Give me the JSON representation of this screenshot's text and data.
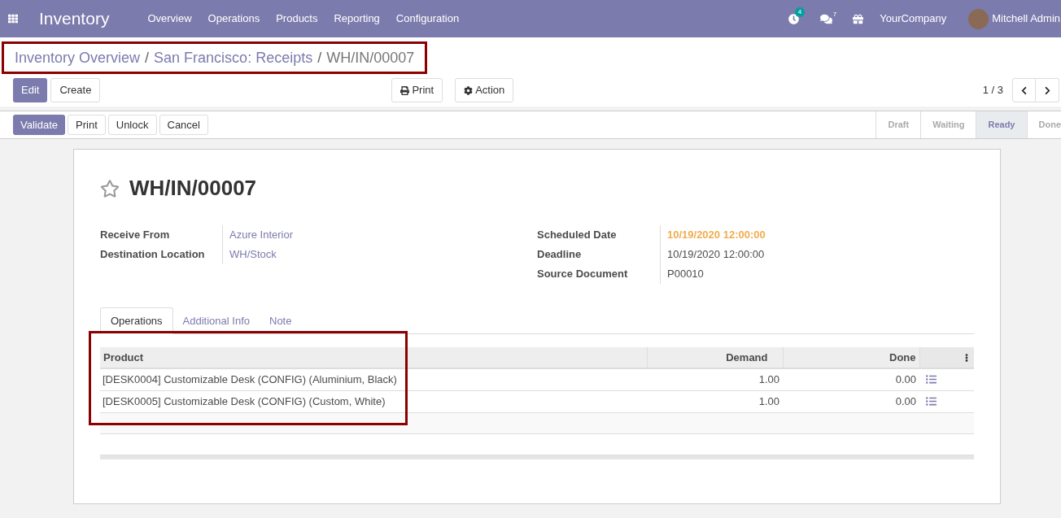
{
  "navbar": {
    "app_name": "Inventory",
    "menu": [
      "Overview",
      "Operations",
      "Products",
      "Reporting",
      "Configuration"
    ],
    "activity_count": "4",
    "message_count": "7",
    "company": "YourCompany",
    "user": "Mitchell Admin"
  },
  "breadcrumb": {
    "links": [
      "Inventory Overview",
      "San Francisco: Receipts"
    ],
    "separator": "/",
    "current": "WH/IN/00007",
    "highlighted": true
  },
  "control_buttons": [
    {
      "label": "Edit",
      "primary": true
    },
    {
      "label": "Create",
      "primary": false
    }
  ],
  "sidebar_buttons": [
    {
      "label": "Print",
      "kind": "print"
    },
    {
      "label": "Action",
      "kind": "action"
    }
  ],
  "pager": {
    "value": "1 / 3"
  },
  "action_buttons": [
    {
      "label": "Validate",
      "primary": true
    },
    {
      "label": "Print",
      "primary": false
    },
    {
      "label": "Unlock",
      "primary": false
    },
    {
      "label": "Cancel",
      "primary": false
    }
  ],
  "statusbar": [
    {
      "label": "Draft",
      "selected": false
    },
    {
      "label": "Waiting",
      "selected": false
    },
    {
      "label": "Ready",
      "selected": true
    },
    {
      "label": "Done",
      "selected": false
    }
  ],
  "record": {
    "title": "WH/IN/00007",
    "starred": false
  },
  "fields_left": [
    {
      "label": "Receive From",
      "value": "Azure Interior",
      "kind": "link"
    },
    {
      "label": "Destination Location",
      "value": "WH/Stock",
      "kind": "link"
    }
  ],
  "fields_right": [
    {
      "label": "Scheduled Date",
      "value": "10/19/2020 12:00:00",
      "kind": "warning"
    },
    {
      "label": "Deadline",
      "value": "10/19/2020 12:00:00",
      "kind": "text"
    },
    {
      "label": "Source Document",
      "value": "P00010",
      "kind": "text"
    }
  ],
  "tabs": [
    {
      "label": "Operations",
      "selected": true
    },
    {
      "label": "Additional Info",
      "selected": false
    },
    {
      "label": "Note",
      "selected": false
    }
  ],
  "table": {
    "columns": [
      "Product",
      "Demand",
      "Done"
    ],
    "highlighted": true,
    "rows": [
      {
        "product": "[DESK0004] Customizable Desk (CONFIG) (Aluminium, Black)",
        "demand": "1.00",
        "done": "0.00"
      },
      {
        "product": "[DESK0005] Customizable Desk (CONFIG) (Custom, White)",
        "demand": "1.00",
        "done": "0.00"
      }
    ]
  }
}
